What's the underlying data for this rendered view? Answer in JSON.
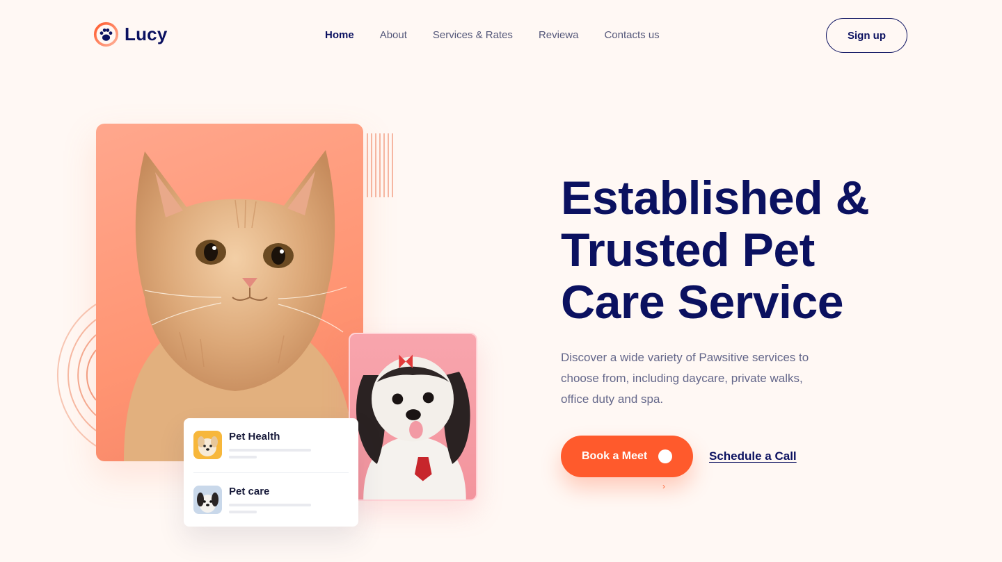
{
  "brand": {
    "name": "Lucy",
    "logo_icon": "paw-icon",
    "accent": "#ff5a2c",
    "navy": "#0b1160"
  },
  "nav": {
    "items": [
      {
        "label": "Home",
        "active": true
      },
      {
        "label": "About"
      },
      {
        "label": "Services & Rates"
      },
      {
        "label": "Reviewa"
      },
      {
        "label": "Contacts us"
      }
    ],
    "signup_label": "Sign up"
  },
  "hero": {
    "headline": "Established & Trusted Pet Care Service",
    "description": "Discover a wide variety of Pawsitive services to choose from, including daycare, private walks, office duty and spa.",
    "primary_cta": "Book a Meet",
    "secondary_cta": "Schedule a Call"
  },
  "services_card": {
    "items": [
      {
        "title": "Pet Health",
        "thumb_icon": "puppy-thumbnail"
      },
      {
        "title": "Pet care",
        "thumb_icon": "dog-thumbnail"
      }
    ]
  },
  "images": {
    "cat": "kitten-photo",
    "dog": "shih-tzu-photo"
  }
}
